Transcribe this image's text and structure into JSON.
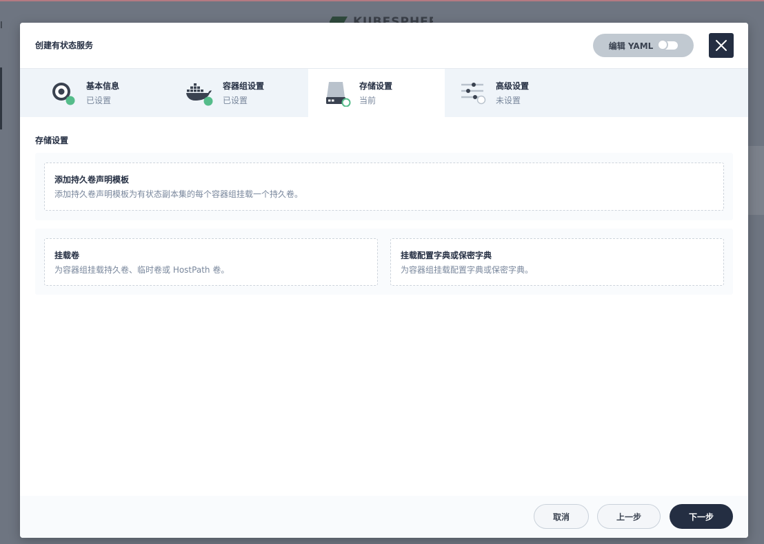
{
  "background": {
    "left_text": "I",
    "logo_text": "KUBESPHERE"
  },
  "modal": {
    "title": "创建有状态服务",
    "yaml_label": "编辑 YAML"
  },
  "steps": [
    {
      "title": "基本信息",
      "status": "已设置"
    },
    {
      "title": "容器组设置",
      "status": "已设置"
    },
    {
      "title": "存储设置",
      "status": "当前"
    },
    {
      "title": "高级设置",
      "status": "未设置"
    }
  ],
  "content": {
    "section_label": "存储设置",
    "pvc_template": {
      "title": "添加持久卷声明模板",
      "desc": "添加持久卷声明模板为有状态副本集的每个容器组挂载一个持久卷。"
    },
    "mount_volume": {
      "title": "挂载卷",
      "desc": "为容器组挂载持久卷、临时卷或 HostPath 卷。"
    },
    "mount_config": {
      "title": "挂载配置字典或保密字典",
      "desc": "为容器组挂载配置字典或保密字典。"
    }
  },
  "footer": {
    "cancel": "取消",
    "prev": "上一步",
    "next": "下一步"
  },
  "colors": {
    "dark": "#242e42",
    "success": "#55bc8a",
    "muted": "#79879c"
  }
}
